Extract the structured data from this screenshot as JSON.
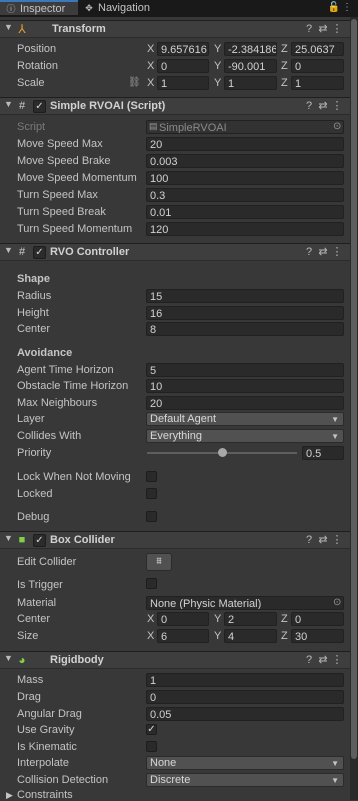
{
  "tabs": [
    {
      "label": "Inspector",
      "icon": "info-icon",
      "active": true
    },
    {
      "label": "Navigation",
      "icon": "navigation-icon",
      "active": false
    }
  ],
  "transform": {
    "title": "Transform",
    "position_label": "Position",
    "position": {
      "x": "9.657616",
      "y": "-2.384186",
      "z": "25.0637"
    },
    "rotation_label": "Rotation",
    "rotation": {
      "x": "0",
      "y": "-90.001",
      "z": "0"
    },
    "scale_label": "Scale",
    "scale": {
      "x": "1",
      "y": "1",
      "z": "1"
    }
  },
  "axes": {
    "x": "X",
    "y": "Y",
    "z": "Z"
  },
  "simple_rvo": {
    "title": "Simple RVOAI (Script)",
    "script_label": "Script",
    "script_value": "SimpleRVOAI",
    "rows": [
      {
        "label": "Move Speed Max",
        "value": "20"
      },
      {
        "label": "Move Speed Brake",
        "value": "0.003"
      },
      {
        "label": "Move Speed Momentum",
        "value": "100"
      },
      {
        "label": "Turn Speed Max",
        "value": "0.3"
      },
      {
        "label": "Turn Speed Break",
        "value": "0.01"
      },
      {
        "label": "Turn Speed Momentum",
        "value": "120"
      }
    ]
  },
  "rvo_controller": {
    "title": "RVO Controller",
    "shape_label": "Shape",
    "radius_label": "Radius",
    "radius": "15",
    "height_label": "Height",
    "height": "16",
    "center_label": "Center",
    "center": "8",
    "avoidance_label": "Avoidance",
    "agent_time_label": "Agent Time Horizon",
    "agent_time": "5",
    "obstacle_time_label": "Obstacle Time Horizon",
    "obstacle_time": "10",
    "max_neighbours_label": "Max Neighbours",
    "max_neighbours": "20",
    "layer_label": "Layer",
    "layer": "Default Agent",
    "collides_label": "Collides With",
    "collides": "Everything",
    "priority_label": "Priority",
    "priority": "0.5",
    "priority_fraction": 0.5,
    "lock_label": "Lock When Not Moving",
    "locked_label": "Locked",
    "debug_label": "Debug"
  },
  "box_collider": {
    "title": "Box Collider",
    "edit_label": "Edit Collider",
    "trigger_label": "Is Trigger",
    "material_label": "Material",
    "material": "None (Physic Material)",
    "center_label": "Center",
    "center": {
      "x": "0",
      "y": "2",
      "z": "0"
    },
    "size_label": "Size",
    "size": {
      "x": "6",
      "y": "4",
      "z": "30"
    }
  },
  "rigidbody": {
    "title": "Rigidbody",
    "mass_label": "Mass",
    "mass": "1",
    "drag_label": "Drag",
    "drag": "0",
    "angular_label": "Angular Drag",
    "angular": "0.05",
    "gravity_label": "Use Gravity",
    "gravity": true,
    "kinematic_label": "Is Kinematic",
    "kinematic": false,
    "interpolate_label": "Interpolate",
    "interpolate": "None",
    "collision_label": "Collision Detection",
    "collision": "Discrete",
    "constraints_label": "Constraints"
  },
  "glyphs": {
    "check": "✓",
    "fold_open": "▼",
    "fold_closed": "▶",
    "dropdown": "▼",
    "help": "?",
    "preset": "⇄",
    "more": "⋮",
    "picker": "⊙",
    "link": "⛓",
    "edit_collider": "⩩"
  }
}
